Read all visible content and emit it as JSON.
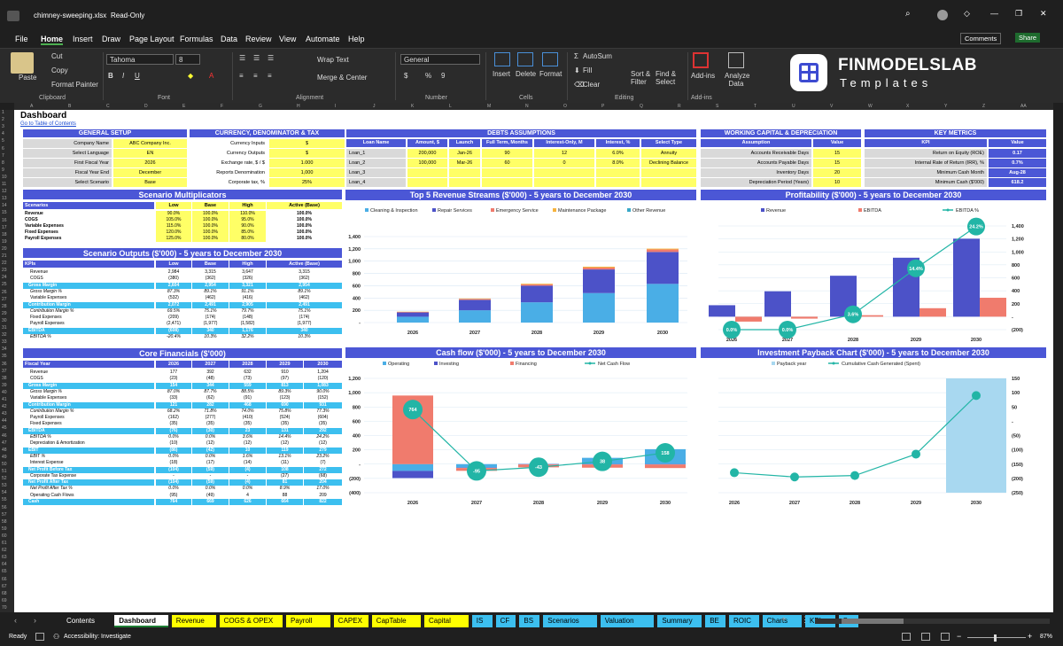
{
  "window": {
    "title": "chimney-sweeping.xlsx",
    "mode": "Read-Only"
  },
  "menu": [
    "File",
    "Home",
    "Insert",
    "Draw",
    "Page Layout",
    "Formulas",
    "Data",
    "Review",
    "View",
    "Automate",
    "Help"
  ],
  "buttons": {
    "comments": "Comments",
    "share": "Share"
  },
  "ribbon": {
    "paste": "Paste",
    "cut": "Cut",
    "copy": "Copy",
    "format_painter": "Format Painter",
    "clipboard": "Clipboard",
    "font_name": "Tahoma",
    "font_size": "8",
    "font": "Font",
    "wrap": "Wrap Text",
    "merge": "Merge & Center",
    "alignment": "Alignment",
    "number_format": "General",
    "number": "Number",
    "insert": "Insert",
    "delete": "Delete",
    "format": "Format",
    "cells": "Cells",
    "autosum": "AutoSum",
    "fill": "Fill",
    "clear": "Clear",
    "sort": "Sort & Filter",
    "find": "Find & Select",
    "editing": "Editing",
    "addins": "Add-ins",
    "analyze": "Analyze Data"
  },
  "logo": {
    "top": "FINMODELSLAB",
    "bottom": "Templates"
  },
  "sheet": {
    "title": "Dashboard",
    "link": "Go to Table of Contents"
  },
  "general": {
    "title": "GENERAL SETUP",
    "rows": [
      [
        "Company Name",
        "ABC Company Inc."
      ],
      [
        "Select Language",
        "EN"
      ],
      [
        "First Fiscal Year",
        "2026"
      ],
      [
        "Fiscal Year End",
        "December"
      ],
      [
        "Select Scenario",
        "Base"
      ]
    ]
  },
  "currency": {
    "title": "CURRENCY, DENOMINATOR & TAX",
    "rows": [
      [
        "Currency Inputs",
        "$"
      ],
      [
        "Currency Outputs",
        "$"
      ],
      [
        "Exchange rate, $ / $",
        "1.000"
      ],
      [
        "Reports Denomination",
        "1,000"
      ],
      [
        "Corporate tax, %",
        "25%"
      ]
    ]
  },
  "debts": {
    "title": "DEBTS ASSUMPTIONS",
    "headers": [
      "Loan Name",
      "Amount, $",
      "Launch",
      "Full Term, Months",
      "Interest-Only, M",
      "Interest, %",
      "Select Type"
    ],
    "rows": [
      [
        "Loan_1",
        "200,000",
        "Jan-26",
        "90",
        "12",
        "6.0%",
        "Annuity"
      ],
      [
        "Loan_2",
        "100,000",
        "Mar-26",
        "60",
        "0",
        "8.0%",
        "Declining Balance"
      ],
      [
        "Loan_3",
        "",
        "",
        "",
        "",
        "",
        ""
      ],
      [
        "Loan_4",
        "",
        "",
        "",
        "",
        "",
        ""
      ]
    ]
  },
  "wc": {
    "title": "WORKING CAPITAL & DEPRECIATION",
    "headers": [
      "Assumption",
      "Value"
    ],
    "rows": [
      [
        "Accounts Receivable Days",
        "15"
      ],
      [
        "Accounts Payable Days",
        "15"
      ],
      [
        "Inventory Days",
        "20"
      ],
      [
        "Depreciation Period (Years)",
        "10"
      ]
    ]
  },
  "kpi": {
    "title": "KEY METRICS",
    "headers": [
      "KPI",
      "Value"
    ],
    "rows": [
      [
        "Return on Equity (ROE)",
        "0.17"
      ],
      [
        "Internal Rate of Return (IRR), %",
        "0.7%"
      ],
      [
        "Minimum Cash Month",
        "Aug-28"
      ],
      [
        "Minimum Cash ($'000)",
        "618.2"
      ]
    ]
  },
  "multipliers": {
    "title": "Scenario Multiplicators",
    "headers": [
      "Scenarios",
      "Low",
      "Base",
      "High",
      "Active (Base)"
    ],
    "rows": [
      [
        "Revenue",
        "90.0%",
        "100.0%",
        "110.0%",
        "100.0%"
      ],
      [
        "COGS",
        "105.0%",
        "100.0%",
        "95.0%",
        "100.0%"
      ],
      [
        "Variable Expenses",
        "115.0%",
        "100.0%",
        "90.0%",
        "100.0%"
      ],
      [
        "Fixed Expenses",
        "120.0%",
        "100.0%",
        "85.0%",
        "100.0%"
      ],
      [
        "Payroll Expenses",
        "125.0%",
        "100.0%",
        "80.0%",
        "100.0%"
      ]
    ]
  },
  "outputs": {
    "title": "Scenario Outputs ($'000) - 5 years to December 2030",
    "headers": [
      "KPIs",
      "Low",
      "Base",
      "High",
      "Active (Base)"
    ],
    "rows": [
      [
        "Revenue",
        "2,984",
        "3,315",
        "3,647",
        "3,315",
        ""
      ],
      [
        "COGS",
        "(380)",
        "(362)",
        "(326)",
        "(362)",
        ""
      ],
      [
        "Gross Margin",
        "2,604",
        "2,954",
        "3,321",
        "2,954",
        "h"
      ],
      [
        "Gross Margin %",
        "87.3%",
        "89.1%",
        "91.1%",
        "89.1%",
        "i"
      ],
      [
        "Variable Expenses",
        "(532)",
        "(462)",
        "(416)",
        "(462)",
        ""
      ],
      [
        "Contribution Margin",
        "2,072",
        "2,491",
        "2,905",
        "2,491",
        "h"
      ],
      [
        "Contribution Margin %",
        "69.5%",
        "75.1%",
        "79.7%",
        "75.1%",
        "i"
      ],
      [
        "Fixed Expenses",
        "(209)",
        "(174)",
        "(148)",
        "(174)",
        ""
      ],
      [
        "Payroll Expenses",
        "(2,471)",
        "(1,977)",
        "(1,582)",
        "(1,977)",
        ""
      ],
      [
        "EBITDA",
        "(608)",
        "340",
        "1,176",
        "340",
        "h"
      ],
      [
        "EBITDA %",
        "-20.4%",
        "10.3%",
        "32.2%",
        "10.3%",
        "i"
      ]
    ]
  },
  "core": {
    "title": "Core Financials ($'000)",
    "headers": [
      "Fiscal Year",
      "2026",
      "2027",
      "2028",
      "2029",
      "2030"
    ],
    "rows": [
      [
        "Revenue",
        "177",
        "392",
        "632",
        "910",
        "1,204",
        ""
      ],
      [
        "COGS",
        "(23)",
        "(48)",
        "(73)",
        "(97)",
        "(120)",
        ""
      ],
      [
        "Gross Margin",
        "154",
        "344",
        "559",
        "813",
        "1,083",
        "h"
      ],
      [
        "Gross Margin %",
        "87.0%",
        "87.7%",
        "88.5%",
        "89.3%",
        "90.0%",
        "i"
      ],
      [
        "Variable Expenses",
        "(33)",
        "(62)",
        "(91)",
        "(123)",
        "(152)",
        ""
      ],
      [
        "Contribution Margin",
        "121",
        "282",
        "468",
        "690",
        "931",
        "h"
      ],
      [
        "Contribution Margin %",
        "68.2%",
        "71.8%",
        "74.0%",
        "75.8%",
        "77.3%",
        "i"
      ],
      [
        "Payroll Expenses",
        "(162)",
        "(277)",
        "(410)",
        "(524)",
        "(604)",
        ""
      ],
      [
        "Fixed Expenses",
        "(35)",
        "(35)",
        "(35)",
        "(35)",
        "(35)",
        ""
      ],
      [
        "EBITDA",
        "(76)",
        "(30)",
        "23",
        "131",
        "292",
        "h"
      ],
      [
        "EBITDA %",
        "0.0%",
        "0.0%",
        "3.6%",
        "14.4%",
        "24.2%",
        "i"
      ],
      [
        "Depreciation & Amortization",
        "(10)",
        "(12)",
        "(12)",
        "(12)",
        "(12)",
        ""
      ],
      [
        "EBIT",
        "(86)",
        "(42)",
        "10",
        "119",
        "279",
        "h"
      ],
      [
        "EBIT %",
        "0.0%",
        "0.0%",
        "1.6%",
        "13.1%",
        "23.2%",
        "i"
      ],
      [
        "Interest Expense",
        "(18)",
        "(17)",
        "(14)",
        "(11)",
        "(7)",
        ""
      ],
      [
        "Net Profit Before Tax",
        "(104)",
        "(59)",
        "(4)",
        "108",
        "272",
        "h"
      ],
      [
        "Corporate Tax Expense",
        "-",
        "-",
        "-",
        "(27)",
        "(68)",
        ""
      ],
      [
        "Net Profit After Tax",
        "(104)",
        "(59)",
        "(4)",
        "81",
        "204",
        "h"
      ],
      [
        "Net Profit After Tax %",
        "0.0%",
        "0.0%",
        "0.0%",
        "8.9%",
        "17.0%",
        "i"
      ],
      [
        "Operating Cash Flows",
        "(95)",
        "(49)",
        "4",
        "88",
        "209",
        ""
      ],
      [
        "Cash",
        "764",
        "669",
        "626",
        "664",
        "822",
        "h"
      ]
    ]
  },
  "charts": {
    "revenue_title": "Top 5 Revenue Streams ($'000) - 5 years to December 2030",
    "profit_title": "Profitability ($'000) - 5 years to December 2030",
    "cash_title": "Cash flow ($'000) - 5 years to December 2030",
    "payback_title": "Investment Payback Chart ($'000) - 5 years to December 2030"
  },
  "chart_data": [
    {
      "type": "bar",
      "title": "Top 5 Revenue Streams ($'000) - 5 years to December 2030",
      "categories": [
        "2026",
        "2027",
        "2028",
        "2029",
        "2030"
      ],
      "ylim": [
        0,
        1400
      ],
      "yticks": [
        "-",
        "200",
        "400",
        "600",
        "800",
        "1,000",
        "1,200",
        "1,400"
      ],
      "series": [
        {
          "name": "Cleaning & Inspection",
          "color": "#4aaee6",
          "values": [
            95,
            200,
            330,
            480,
            630
          ]
        },
        {
          "name": "Repair Services",
          "color": "#4c52c8",
          "values": [
            70,
            170,
            270,
            385,
            520
          ]
        },
        {
          "name": "Emergency Service",
          "color": "#f07b6d",
          "values": [
            8,
            15,
            20,
            30,
            40
          ]
        },
        {
          "name": "Maintenance Package",
          "color": "#f6b33e",
          "values": [
            4,
            7,
            12,
            15,
            14
          ]
        },
        {
          "name": "Other Revenue",
          "color": "#3aa8c8",
          "values": [
            0,
            0,
            0,
            0,
            0
          ]
        }
      ]
    },
    {
      "type": "bar",
      "title": "Profitability ($'000) - 5 years to December 2030",
      "categories": [
        "2026",
        "2027",
        "2028",
        "2029",
        "2030"
      ],
      "ylim": [
        -200,
        1400
      ],
      "yticks": [
        "(200)",
        "-",
        "200",
        "400",
        "600",
        "800",
        "1,000",
        "1,200",
        "1,400"
      ],
      "series": [
        {
          "name": "Revenue",
          "color": "#4c52c8",
          "values": [
            177,
            392,
            632,
            910,
            1204
          ]
        },
        {
          "name": "EBITDA",
          "color": "#f07b6d",
          "values": [
            -76,
            -30,
            23,
            131,
            292
          ]
        },
        {
          "name": "EBITDA %",
          "color": "#22b5a6",
          "values": [
            0.0,
            0.0,
            3.6,
            14.4,
            24.2
          ],
          "labels": [
            "0.0%",
            "0.0%",
            "3.6%",
            "14.4%",
            "24.2%"
          ]
        }
      ]
    },
    {
      "type": "bar",
      "title": "Cash flow ($'000) - 5 years to December 2030",
      "categories": [
        "2026",
        "2027",
        "2028",
        "2029",
        "2030"
      ],
      "ylim": [
        -400,
        1200
      ],
      "yticks": [
        "(400)",
        "(200)",
        "-",
        "200",
        "400",
        "600",
        "800",
        "1,000",
        "1,200"
      ],
      "series": [
        {
          "name": "Operating",
          "color": "#4aaee6",
          "values": [
            -95,
            -49,
            4,
            88,
            209
          ]
        },
        {
          "name": "Investing",
          "color": "#4c52c8",
          "values": [
            -100,
            -5,
            -5,
            -5,
            -5
          ]
        },
        {
          "name": "Financing",
          "color": "#f07b6d",
          "values": [
            960,
            -40,
            -40,
            -45,
            -50
          ]
        },
        {
          "name": "Net Cash Flow",
          "color": "#22b5a6",
          "values": [
            764,
            -95,
            -43,
            38,
            158
          ]
        }
      ]
    },
    {
      "type": "bar",
      "title": "Investment Payback Chart ($'000) - 5 years to December 2030",
      "categories": [
        "2026",
        "2027",
        "2028",
        "2029",
        "2030"
      ],
      "ylim": [
        -250,
        150
      ],
      "yticks": [
        "(250)",
        "(200)",
        "(150)",
        "(100)",
        "(50)",
        "-",
        "50",
        "100",
        "150"
      ],
      "series": [
        {
          "name": "Payback year",
          "color": "#a8d8f0",
          "values": [
            0,
            0,
            0,
            0,
            1
          ]
        },
        {
          "name": "Cumulative Cash Generated (Spent)",
          "color": "#22b5a6",
          "values": [
            -180,
            -195,
            -190,
            -115,
            90
          ]
        }
      ]
    }
  ],
  "sheet_tabs": [
    {
      "name": "Contents",
      "c": ""
    },
    {
      "name": "Dashboard",
      "c": "active"
    },
    {
      "name": "Revenue",
      "c": "y"
    },
    {
      "name": "COGS & OPEX",
      "c": "y"
    },
    {
      "name": "Payroll",
      "c": "y"
    },
    {
      "name": "CAPEX",
      "c": "y"
    },
    {
      "name": "CapTable",
      "c": "y"
    },
    {
      "name": "Capital",
      "c": "y"
    },
    {
      "name": "IS",
      "c": "b"
    },
    {
      "name": "CF",
      "c": "b"
    },
    {
      "name": "BS",
      "c": "b"
    },
    {
      "name": "Scenarios",
      "c": "b"
    },
    {
      "name": "Valuation",
      "c": "b"
    },
    {
      "name": "Summary",
      "c": "b"
    },
    {
      "name": "BE",
      "c": "b"
    },
    {
      "name": "ROIC",
      "c": "b"
    },
    {
      "name": "Charts",
      "c": "b"
    },
    {
      "name": "KPIs",
      "c": "b"
    },
    {
      "name": "Se",
      "c": "b"
    }
  ],
  "status": {
    "ready": "Ready",
    "accessibility": "Accessibility: Investigate",
    "zoom": "87%"
  }
}
